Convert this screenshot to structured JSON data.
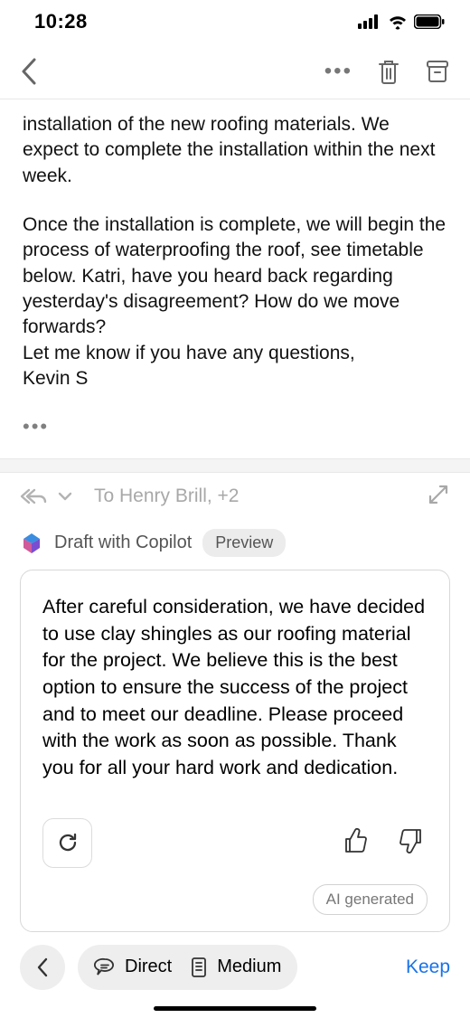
{
  "status": {
    "time": "10:28"
  },
  "email": {
    "para1": "installation of the new roofing materials. We expect to complete the installation within the next week.",
    "para2": "Once the installation is complete, we will begin the process of waterproofing the roof, see timetable below. Katri, have you heard back regarding yesterday's disagreement? How do we move forwards?",
    "closing": "Let me know if you have any questions,",
    "signature": "Kevin S"
  },
  "reply": {
    "to_line": "To Henry Brill, +2"
  },
  "copilot": {
    "label": "Draft with Copilot",
    "preview": "Preview",
    "draft_text": "After careful consideration, we have decided to use clay shingles as our roofing material for the project. We believe this is the best option to ensure the success of the project and to meet our deadline. Please proceed with the work as soon as possible.  Thank you for all your hard work and dedication.",
    "ai_generated": "AI generated"
  },
  "bottom": {
    "direct": "Direct",
    "medium": "Medium",
    "keep": "Keep"
  }
}
